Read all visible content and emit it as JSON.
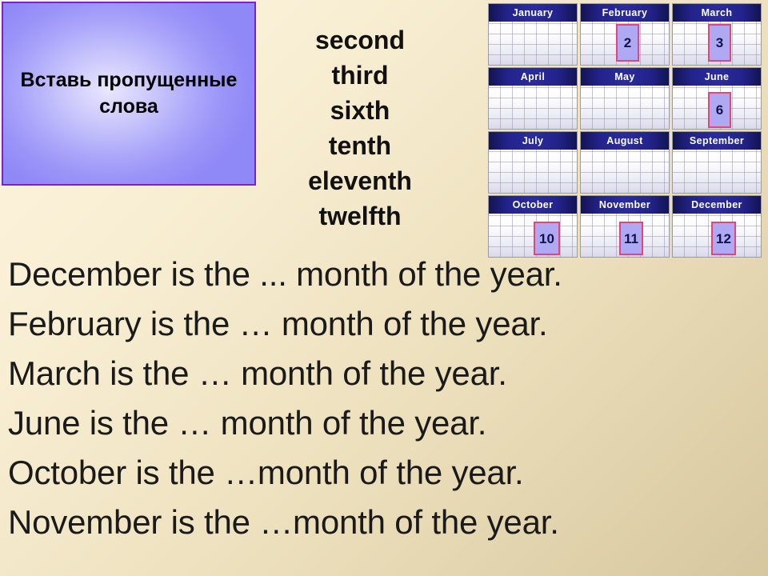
{
  "title_box": {
    "text": "Вставь пропущенные слова",
    "border_color": "#7a22cc",
    "fill_color": "#a9a4fa"
  },
  "word_list": {
    "words": [
      {
        "label": "second"
      },
      {
        "label": "third"
      },
      {
        "label": "sixth"
      },
      {
        "label": "tenth"
      },
      {
        "label": "eleventh"
      },
      {
        "label": "twelfth"
      }
    ]
  },
  "calendar": {
    "header_color": "#23238c",
    "highlight_fill": "#afa8f2",
    "highlight_border": "#e1457c",
    "months": [
      {
        "name": "January",
        "highlight": null
      },
      {
        "name": "February",
        "highlight": "2"
      },
      {
        "name": "March",
        "highlight": "3"
      },
      {
        "name": "April",
        "highlight": null
      },
      {
        "name": "May",
        "highlight": null
      },
      {
        "name": "June",
        "highlight": "6"
      },
      {
        "name": "July",
        "highlight": null
      },
      {
        "name": "August",
        "highlight": null
      },
      {
        "name": "September",
        "highlight": null
      },
      {
        "name": "October",
        "highlight": "10"
      },
      {
        "name": "November",
        "highlight": "11"
      },
      {
        "name": "December",
        "highlight": "12"
      }
    ]
  },
  "sentences": {
    "lines": [
      {
        "text": "December is the ... month of the year."
      },
      {
        "text": "February is the … month of the year."
      },
      {
        "text": "March is the … month of the year."
      },
      {
        "text": "June is the … month of the year."
      },
      {
        "text": "October is the …month of the year."
      },
      {
        "text": "November is the …month of the year."
      }
    ]
  }
}
